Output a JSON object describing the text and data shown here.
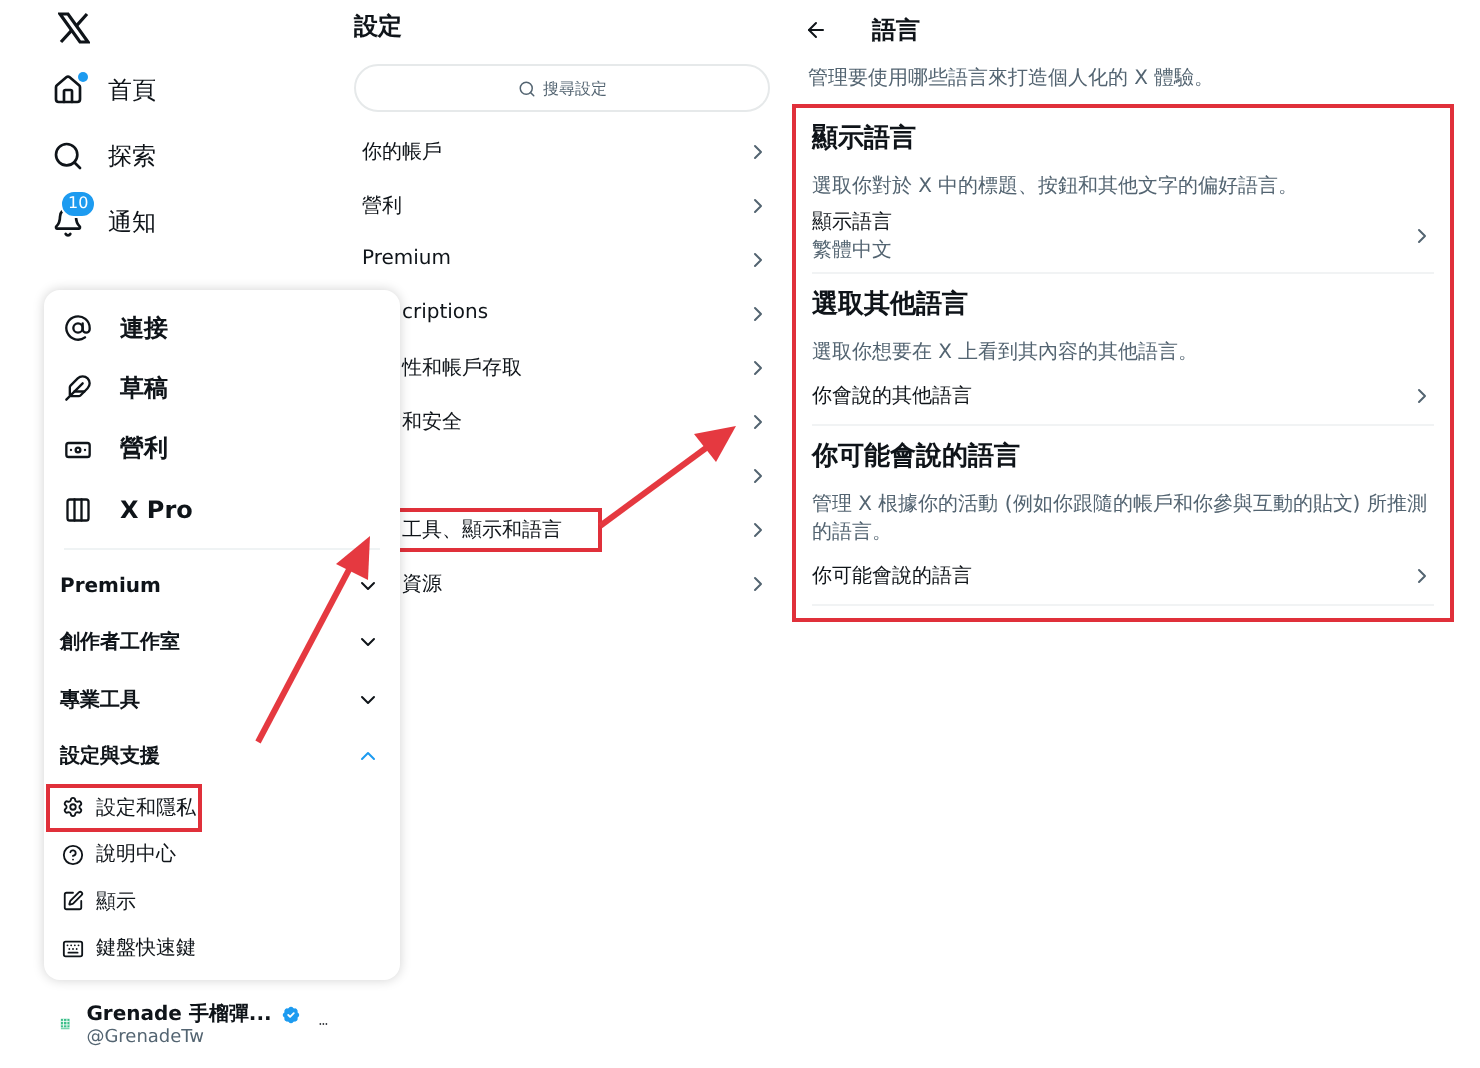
{
  "nav": {
    "items": [
      {
        "label": "首頁",
        "dot": true
      },
      {
        "label": "探索"
      },
      {
        "label": "通知",
        "badge": "10"
      }
    ]
  },
  "menu": {
    "items": [
      {
        "label": "連接"
      },
      {
        "label": "草稿"
      },
      {
        "label": "營利"
      },
      {
        "label": "X Pro"
      }
    ],
    "groups": [
      {
        "label": "Premium",
        "expanded": false
      },
      {
        "label": "創作者工作室",
        "expanded": false
      },
      {
        "label": "專業工具",
        "expanded": false
      },
      {
        "label": "設定與支援",
        "expanded": true
      }
    ],
    "subitems": [
      {
        "label": "設定和隱私",
        "highlighted": true
      },
      {
        "label": "說明中心",
        "highlighted": false
      },
      {
        "label": "顯示",
        "highlighted": false
      },
      {
        "label": "鍵盤快速鍵",
        "highlighted": false
      }
    ]
  },
  "account": {
    "name": "Grenade 手榴彈...",
    "handle": "@GrenadeTw",
    "verified": true
  },
  "settings": {
    "title": "設定",
    "search": {
      "placeholder": "搜尋設定"
    },
    "items": [
      {
        "label": "你的帳戶",
        "kind": "full"
      },
      {
        "label": "營利",
        "kind": "full"
      },
      {
        "label": "Premium",
        "kind": "full"
      },
      {
        "label": "criptions",
        "kind": "cut"
      },
      {
        "label": "性和帳戶存取",
        "kind": "cut"
      },
      {
        "label": "和安全",
        "kind": "cut"
      },
      {
        "kind": "hidden"
      },
      {
        "label": "工具、顯示和語言",
        "kind": "cut",
        "highlighted": true
      },
      {
        "label": "資源",
        "kind": "cut"
      }
    ]
  },
  "language": {
    "title": "語言",
    "description": "管理要使用哪些語言來打造個人化的 X 體驗。",
    "highlighted": true,
    "sections": [
      {
        "heading": "顯示語言",
        "description": "選取你對於 X 中的標題、按鈕和其他文字的偏好語言。",
        "row": {
          "label": "顯示語言",
          "value": "繁體中文"
        }
      },
      {
        "heading": "選取其他語言",
        "description": "選取你想要在 X 上看到其內容的其他語言。",
        "row": {
          "label": "你會說的其他語言"
        }
      },
      {
        "heading": "你可能會說的語言",
        "description": "管理 X 根據你的活動 (例如你跟隨的帳戶和你參與互動的貼文) 所推測的語言。",
        "row": {
          "label": "你可能會說的語言"
        }
      }
    ]
  }
}
